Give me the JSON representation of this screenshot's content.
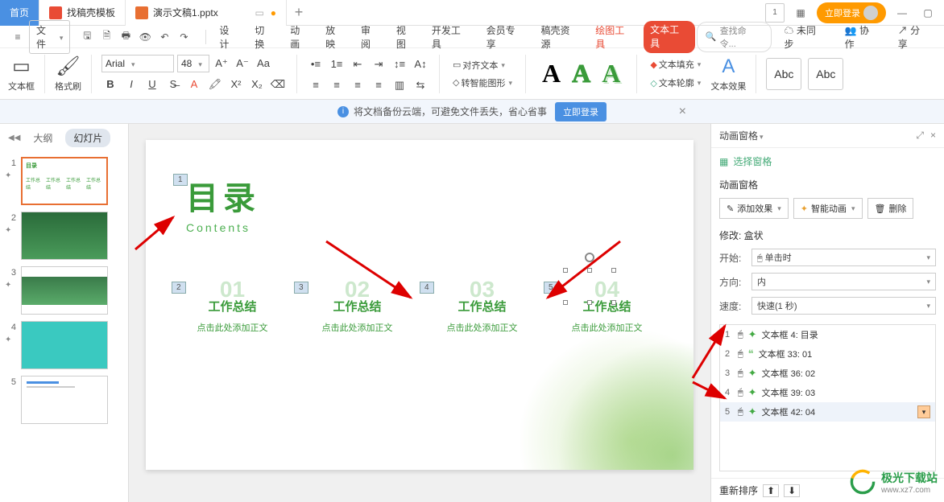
{
  "titlebar": {
    "home": "首页",
    "tab_find": "找稿壳模板",
    "tab_doc": "演示文稿1.pptx",
    "login": "立即登录"
  },
  "menu": {
    "file": "文件",
    "tabs": [
      "设计",
      "切换",
      "动画",
      "放映",
      "审阅",
      "视图",
      "开发工具",
      "会员专享",
      "稿壳资源"
    ],
    "draw_tool": "绘图工具",
    "text_tool": "文本工具",
    "search_ph": "查找命令...",
    "unsync": "未同步",
    "coop": "协作",
    "share": "分享"
  },
  "ribbon": {
    "textbox": "文本框",
    "format_painter": "格式刷",
    "font_name": "Arial",
    "font_size": "48",
    "align_text": "对齐文本",
    "smart_graphic": "转智能图形",
    "text_fill": "文本填充",
    "text_outline": "文本轮廓",
    "text_effect": "文本效果",
    "preset": "Abc",
    "preset2": "Abc"
  },
  "notice": {
    "text": "将文档备份云端，可避免文件丢失，省心省事",
    "btn": "立即登录"
  },
  "thumb_tabs": {
    "outline": "大纲",
    "slides": "幻灯片"
  },
  "slide": {
    "title": "目录",
    "subtitle": "Contents",
    "items": [
      {
        "num": "01",
        "title": "工作总结",
        "sub": "点击此处添加正文"
      },
      {
        "num": "02",
        "title": "工作总结",
        "sub": "点击此处添加正文"
      },
      {
        "num": "03",
        "title": "工作总结",
        "sub": "点击此处添加正文"
      },
      {
        "num": "04",
        "title": "工作总结",
        "sub": "点击此处添加正文"
      }
    ],
    "tags": [
      "1",
      "2",
      "3",
      "4",
      "5"
    ]
  },
  "anim": {
    "header": "动画窗格",
    "select_pane": "选择窗格",
    "section": "动画窗格",
    "add_effect": "添加效果",
    "smart_anim": "智能动画",
    "delete": "删除",
    "modify": "修改: 盒状",
    "start_label": "开始:",
    "start_val": "单击时",
    "dir_label": "方向:",
    "dir_val": "内",
    "speed_label": "速度:",
    "speed_val": "快速(1 秒)",
    "items": [
      {
        "n": "1",
        "label": "文本框 4: 目录"
      },
      {
        "n": "2",
        "label": "文本框 33: 01"
      },
      {
        "n": "3",
        "label": "文本框 36: 02"
      },
      {
        "n": "4",
        "label": "文本框 39: 03"
      },
      {
        "n": "5",
        "label": "文本框 42: 04"
      }
    ],
    "reorder": "重新排序"
  },
  "watermark": {
    "l1": "极光下载站",
    "l2": "www.xz7.com"
  }
}
